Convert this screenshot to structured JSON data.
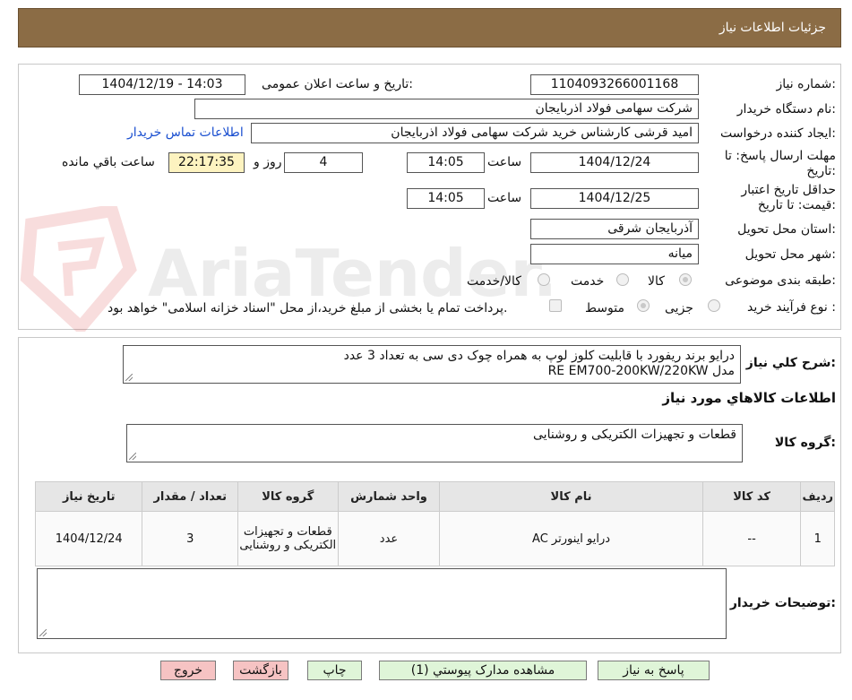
{
  "header": {
    "title": "جزئیات اطلاعات نیاز"
  },
  "form": {
    "need_number_label": "شماره نیاز:",
    "need_number": "1104093266001168",
    "announce_label": "تاریخ و ساعت اعلان عمومی:",
    "announce_value": "1404/12/19 - 14:03",
    "buyer_label": "نام دستگاه خریدار:",
    "buyer_value": "شرکت سهامی فولاد اذربایجان",
    "creator_label": "ایجاد کننده درخواست:",
    "creator_value": "امید قرشی کارشناس خرید شرکت سهامی فولاد اذربایجان",
    "contact_link": "اطلاعات تماس خریدار",
    "deadline_label": "مهلت ارسال پاسخ: تا تاریخ:",
    "deadline_date": "1404/12/24",
    "time_label": "ساعت",
    "deadline_time": "14:05",
    "days_value": "4",
    "days_label": "روز و",
    "remaining_time": "22:17:35",
    "remaining_label": "ساعت باقي مانده",
    "validity_label": "حداقل تاریخ اعتبار قیمت: تا تاریخ:",
    "validity_date": "1404/12/25",
    "validity_time": "14:05",
    "province_label": "استان محل تحویل:",
    "province_value": "آذربایجان شرقی",
    "city_label": "شهر محل تحویل:",
    "city_value": "میانه",
    "category_label": "طبقه بندی موضوعی:",
    "category_options": [
      "کالا",
      "خدمت",
      "کالا/خدمت"
    ],
    "process_label": "نوع فرآیند خرید :",
    "process_options": [
      "جزیی",
      "متوسط"
    ],
    "payment_note": "پرداخت تمام یا بخشی از مبلغ خرید،از محل \"اسناد خزانه اسلامی\" خواهد بود."
  },
  "summary": {
    "label": "شرح کلي نياز:",
    "line1": "درایو  برند ریفورد با قابلیت کلوز لوپ به همراه چوک دی سی به تعداد 3 عدد",
    "line2": "مدل RE EM700-200KW/220KW"
  },
  "goods_info": {
    "title": "اطلاعات کالاهاي مورد نياز",
    "group_label": "گروه کالا:",
    "group_value": "قطعات و تجهیزات الکتریکی و روشنایی"
  },
  "table": {
    "headers": [
      "ردیف",
      "کد کالا",
      "نام کالا",
      "واحد شمارش",
      "گروه کالا",
      "تعداد / مقدار",
      "تاریخ نیاز"
    ],
    "rows": [
      [
        "1",
        "--",
        "درایو اینورتر AC",
        "عدد",
        "قطعات و تجهیزات الکتریکی و روشنایی",
        "3",
        "1404/12/24"
      ]
    ]
  },
  "buyer_notes": {
    "label": "توضیحات خریدار:"
  },
  "buttons": {
    "reply": "پاسخ به نیاز",
    "attachments": "مشاهده مدارک پیوستي (1)",
    "print": "چاپ",
    "back": "بازگشت",
    "exit": "خروج"
  },
  "colors": {
    "header_bg": "#8b6c45",
    "link": "#1a4fd0",
    "green_button": "#dff5d8",
    "red_button": "#f6c3c3",
    "timer_bg": "#fdf3c0"
  }
}
